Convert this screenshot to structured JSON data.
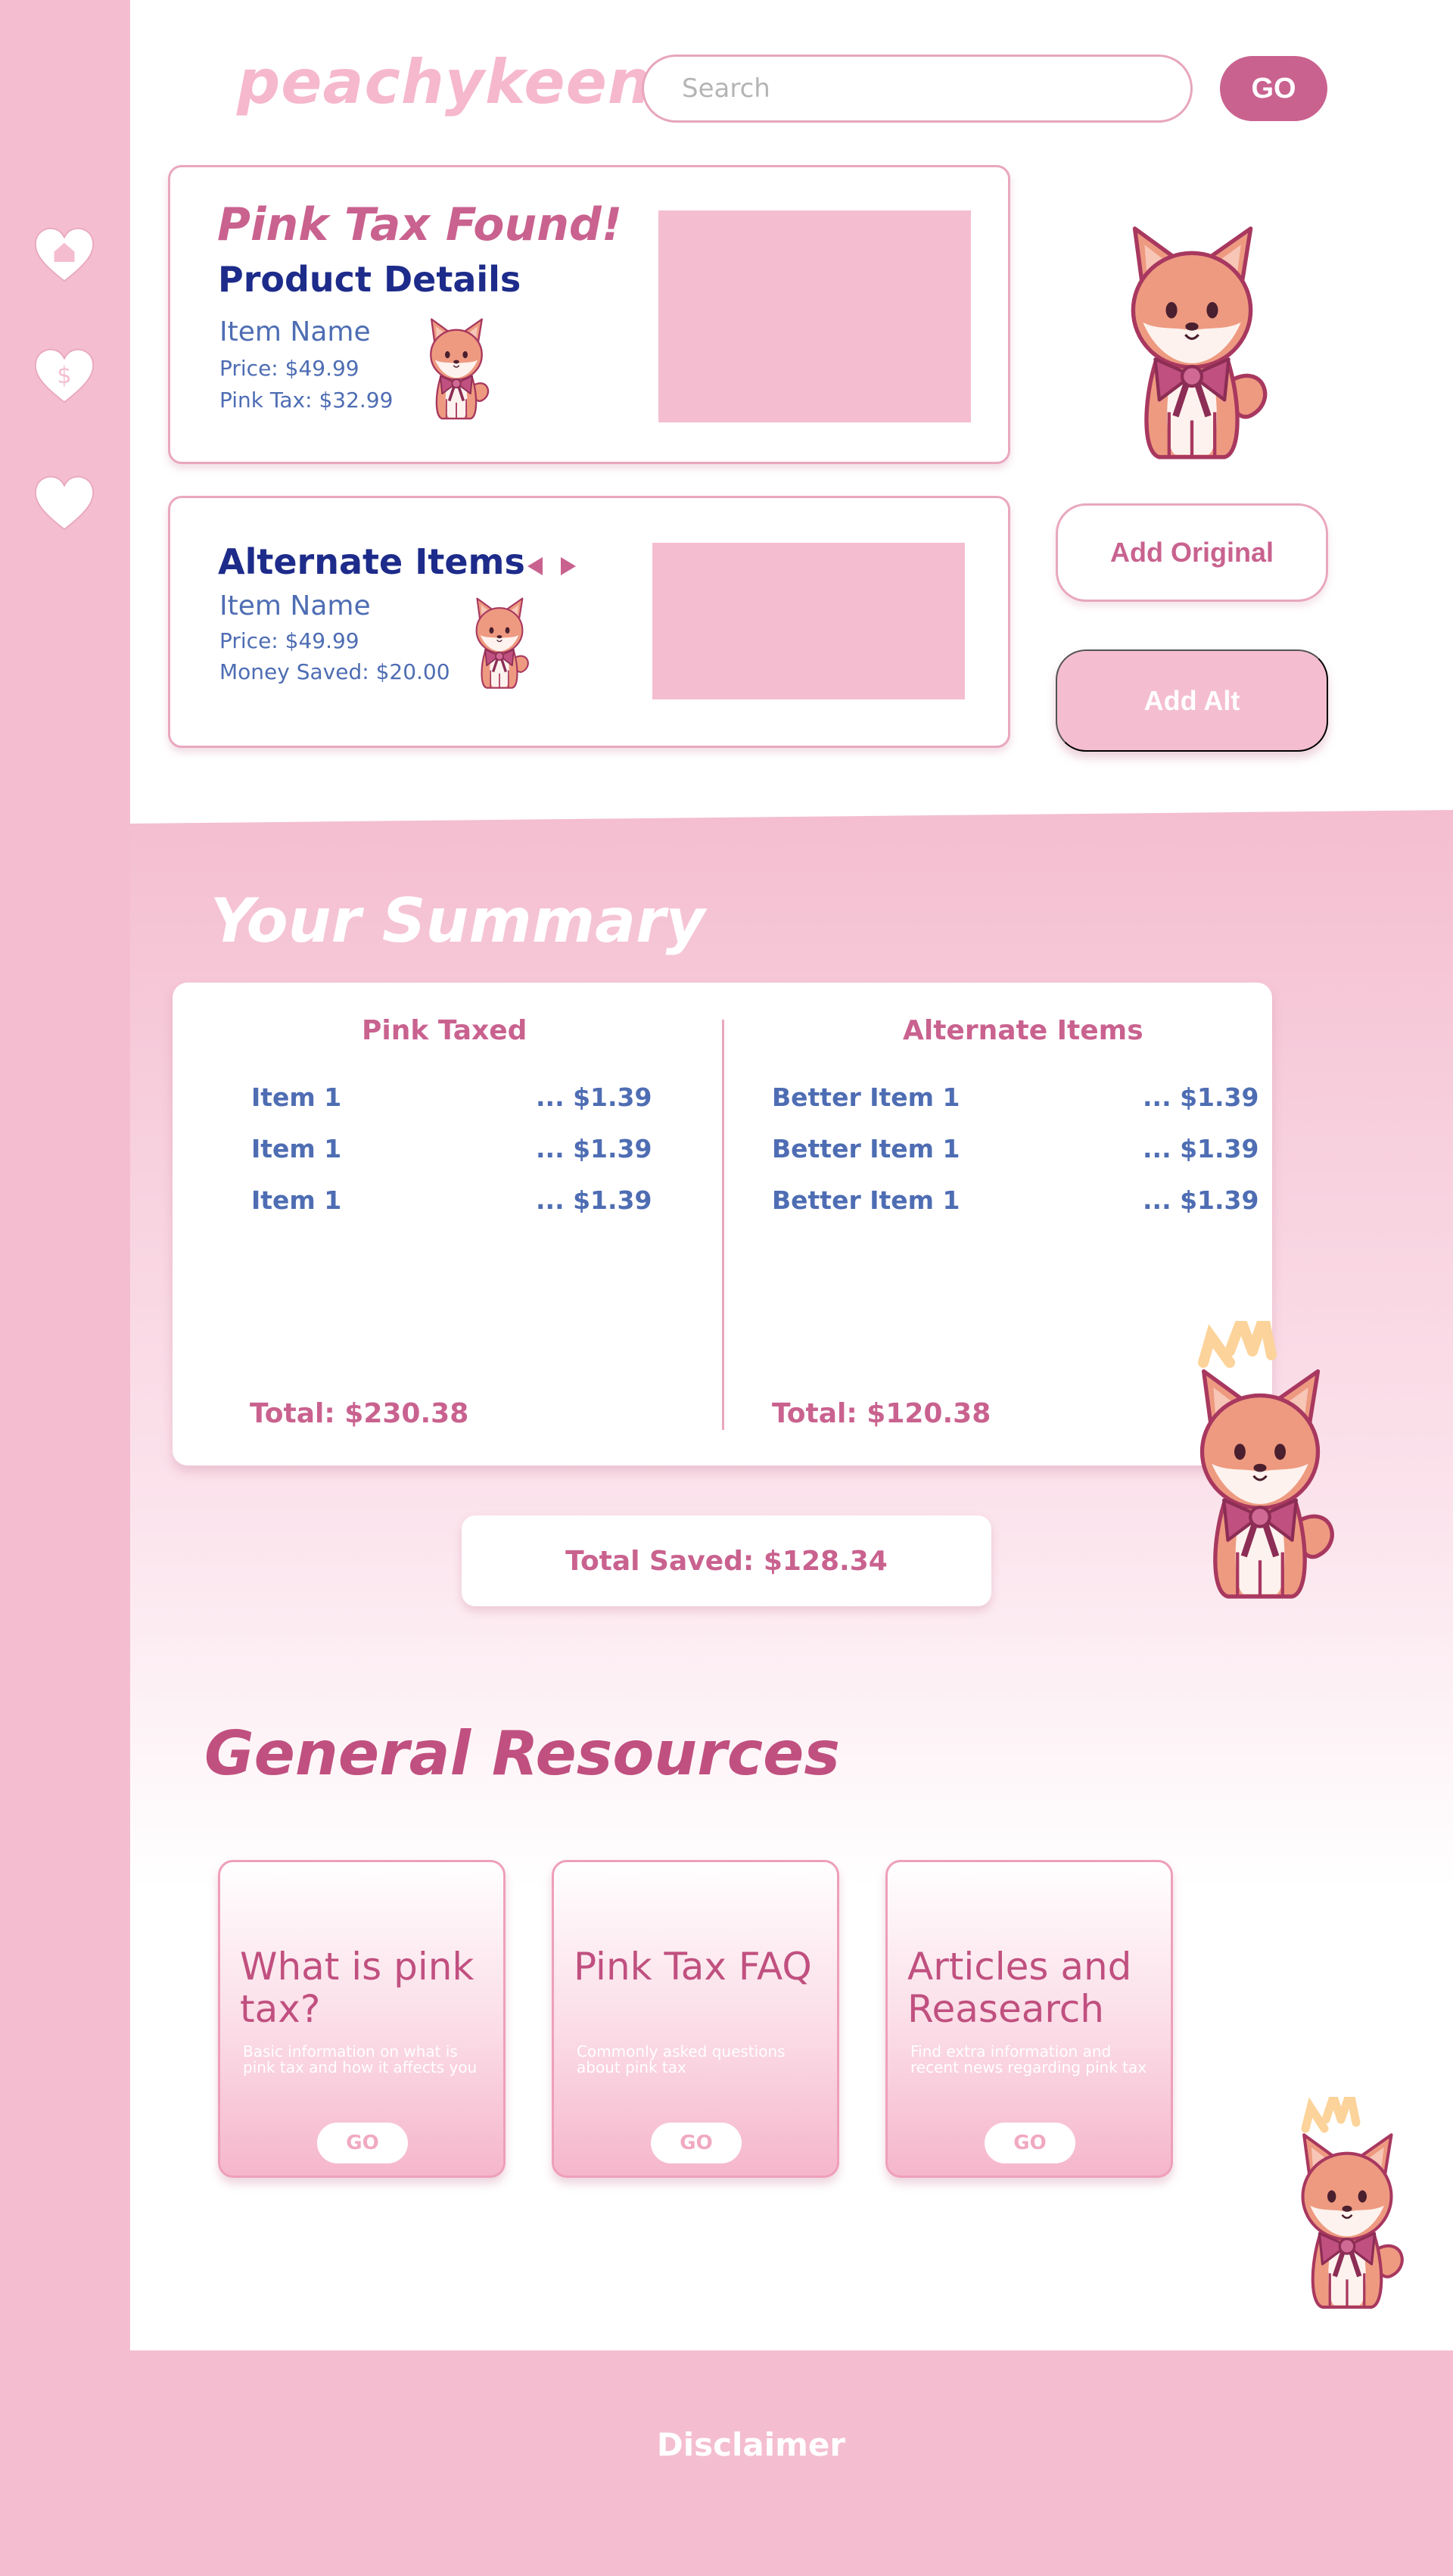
{
  "app": {
    "logo": "peachykeen"
  },
  "search": {
    "placeholder": "Search",
    "go_label": "GO"
  },
  "sidebar": {
    "items": [
      "home-icon",
      "dollar-icon",
      "heart-icon"
    ]
  },
  "product": {
    "heading": "Pink Tax Found!",
    "subheading": "Product Details",
    "item_name": "Item Name",
    "price": "Price: $49.99",
    "pink_tax": "Pink Tax: $32.99"
  },
  "alternate": {
    "heading": "Alternate Items",
    "item_name": "Item Name",
    "price": "Price: $49.99",
    "money_saved": "Money Saved: $20.00"
  },
  "actions": {
    "add_original": "Add Original",
    "add_alt": "Add Alt"
  },
  "summary": {
    "heading": "Your Summary",
    "pink_taxed": {
      "title": "Pink Taxed",
      "items": [
        {
          "name": "Item 1",
          "price": "... $1.39"
        },
        {
          "name": "Item 1",
          "price": "... $1.39"
        },
        {
          "name": "Item 1",
          "price": "... $1.39"
        }
      ],
      "total": "Total: $230.38"
    },
    "alternate": {
      "title": "Alternate Items",
      "items": [
        {
          "name": "Better Item 1",
          "price": "... $1.39"
        },
        {
          "name": "Better Item 1",
          "price": "... $1.39"
        },
        {
          "name": "Better Item 1",
          "price": "... $1.39"
        }
      ],
      "total": "Total: $120.38"
    },
    "total_saved": "Total Saved: $128.34"
  },
  "resources": {
    "heading": "General Resources",
    "cards": [
      {
        "title": "What is pink tax?",
        "desc": "Basic information on what is pink tax and how it affects you",
        "go": "GO"
      },
      {
        "title": "Pink Tax FAQ",
        "desc": "Commonly asked questions about pink tax",
        "go": "GO"
      },
      {
        "title": "Articles and Reasearch",
        "desc": "Find extra information and recent news regarding pink tax",
        "go": "GO"
      }
    ]
  },
  "footer": {
    "disclaimer": "Disclaimer"
  },
  "colors": {
    "accent": "#c9628f",
    "pink_bg": "#f4bed0",
    "navy": "#1d2b8a",
    "blue": "#4e6db3"
  }
}
